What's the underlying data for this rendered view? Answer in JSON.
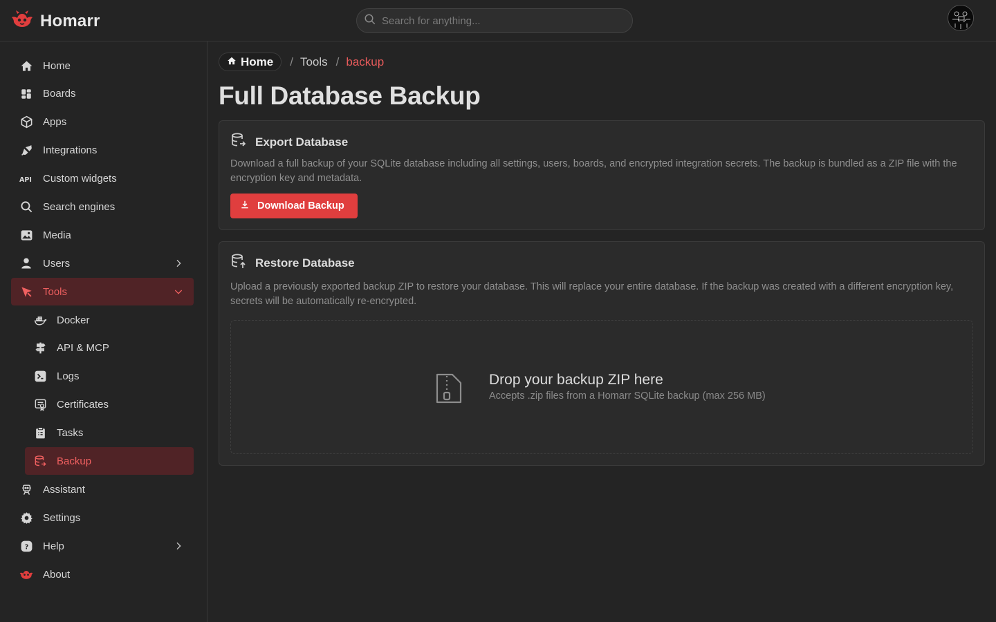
{
  "app": {
    "name": "Homarr"
  },
  "search": {
    "placeholder": "Search for anything..."
  },
  "sidebar": {
    "items": [
      {
        "label": "Home",
        "icon": "home-icon"
      },
      {
        "label": "Boards",
        "icon": "boards-icon"
      },
      {
        "label": "Apps",
        "icon": "box-icon"
      },
      {
        "label": "Integrations",
        "icon": "plug-icon"
      },
      {
        "label": "Custom widgets",
        "icon": "api-icon"
      },
      {
        "label": "Search engines",
        "icon": "search-icon"
      },
      {
        "label": "Media",
        "icon": "photo-icon"
      },
      {
        "label": "Users",
        "icon": "user-icon"
      },
      {
        "label": "Tools",
        "icon": "tools-icon"
      },
      {
        "label": "Docker",
        "icon": "docker-icon"
      },
      {
        "label": "API & MCP",
        "icon": "signpost-icon"
      },
      {
        "label": "Logs",
        "icon": "terminal-icon"
      },
      {
        "label": "Certificates",
        "icon": "certificate-icon"
      },
      {
        "label": "Tasks",
        "icon": "report-icon"
      },
      {
        "label": "Backup",
        "icon": "database-icon"
      },
      {
        "label": "Assistant",
        "icon": "robot-icon"
      },
      {
        "label": "Settings",
        "icon": "gear-icon"
      },
      {
        "label": "Help",
        "icon": "help-icon"
      },
      {
        "label": "About",
        "icon": "logo-icon"
      }
    ]
  },
  "breadcrumb": {
    "home": "Home",
    "tools": "Tools",
    "current": "backup",
    "separator": "/"
  },
  "page": {
    "title": "Full Database Backup"
  },
  "export": {
    "title": "Export Database",
    "description": "Download a full backup of your SQLite database including all settings, users, boards, and encrypted integration secrets. The backup is bundled as a ZIP file with the encryption key and metadata.",
    "button": "Download Backup"
  },
  "restore": {
    "title": "Restore Database",
    "description": "Upload a previously exported backup ZIP to restore your database. This will replace your entire database. If the backup was created with a different encryption key, secrets will be automatically re-encrypted.",
    "drop_title": "Drop your backup ZIP here",
    "drop_subtitle": "Accepts .zip files from a Homarr SQLite backup (max 256 MB)"
  },
  "colors": {
    "accent": "#e03e3e",
    "active_bg": "#502326",
    "active_text": "#f06060",
    "background": "#242424",
    "card": "#2b2b2b"
  }
}
